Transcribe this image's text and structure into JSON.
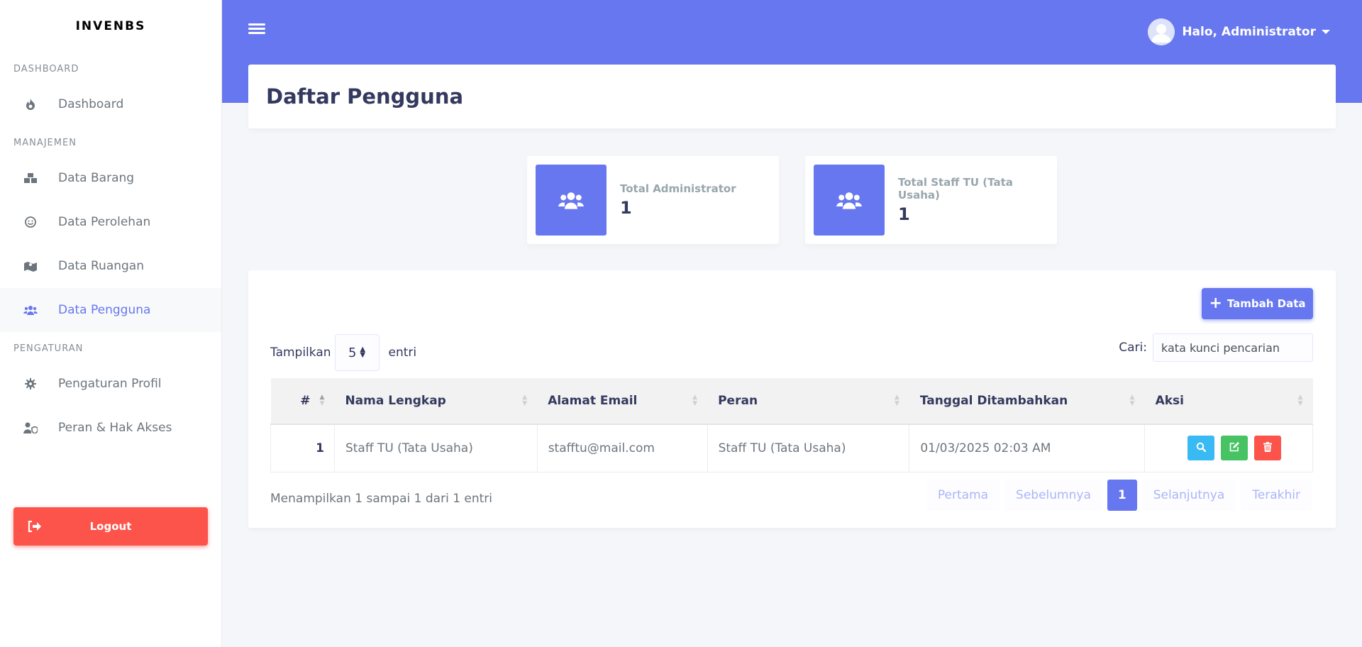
{
  "brand": "INVENBS",
  "sidebar": {
    "sections": [
      {
        "header": "DASHBOARD",
        "items": [
          {
            "label": "Dashboard",
            "icon": "fire-icon"
          }
        ]
      },
      {
        "header": "MANAJEMEN",
        "items": [
          {
            "label": "Data Barang",
            "icon": "boxes-icon"
          },
          {
            "label": "Data Perolehan",
            "icon": "smile-icon"
          },
          {
            "label": "Data Ruangan",
            "icon": "map-icon"
          },
          {
            "label": "Data Pengguna",
            "icon": "users-icon",
            "active": true
          }
        ]
      },
      {
        "header": "PENGATURAN",
        "items": [
          {
            "label": "Pengaturan Profil",
            "icon": "cog-icon"
          },
          {
            "label": "Peran & Hak Akses",
            "icon": "user-shield-icon"
          }
        ]
      }
    ],
    "logout_label": "Logout"
  },
  "navbar": {
    "user_greeting": "Halo, Administrator"
  },
  "page_title": "Daftar Pengguna",
  "stats": [
    {
      "title": "Total Administrator",
      "value": "1"
    },
    {
      "title": "Total Staff TU (Tata Usaha)",
      "value": "1"
    }
  ],
  "card": {
    "add_button": "Tambah Data",
    "length": {
      "prefix": "Tampilkan",
      "value": "5",
      "suffix": "entri"
    },
    "search": {
      "label": "Cari:",
      "placeholder": "kata kunci pencarian"
    },
    "columns": [
      "#",
      "Nama Lengkap",
      "Alamat Email",
      "Peran",
      "Tanggal Ditambahkan",
      "Aksi"
    ],
    "rows": [
      {
        "no": "1",
        "name": "Staff TU (Tata Usaha)",
        "email": "stafftu@mail.com",
        "role": "Staff TU (Tata Usaha)",
        "date": "01/03/2025 02:03 AM"
      }
    ],
    "info": "Menampilkan 1 sampai 1 dari 1 entri",
    "pagination": {
      "first": "Pertama",
      "prev": "Sebelumnya",
      "current": "1",
      "next": "Selanjutnya",
      "last": "Terakhir"
    }
  },
  "colors": {
    "primary": "#6777ef",
    "info": "#3abaf4",
    "success": "#47c363",
    "danger": "#fc544b"
  }
}
